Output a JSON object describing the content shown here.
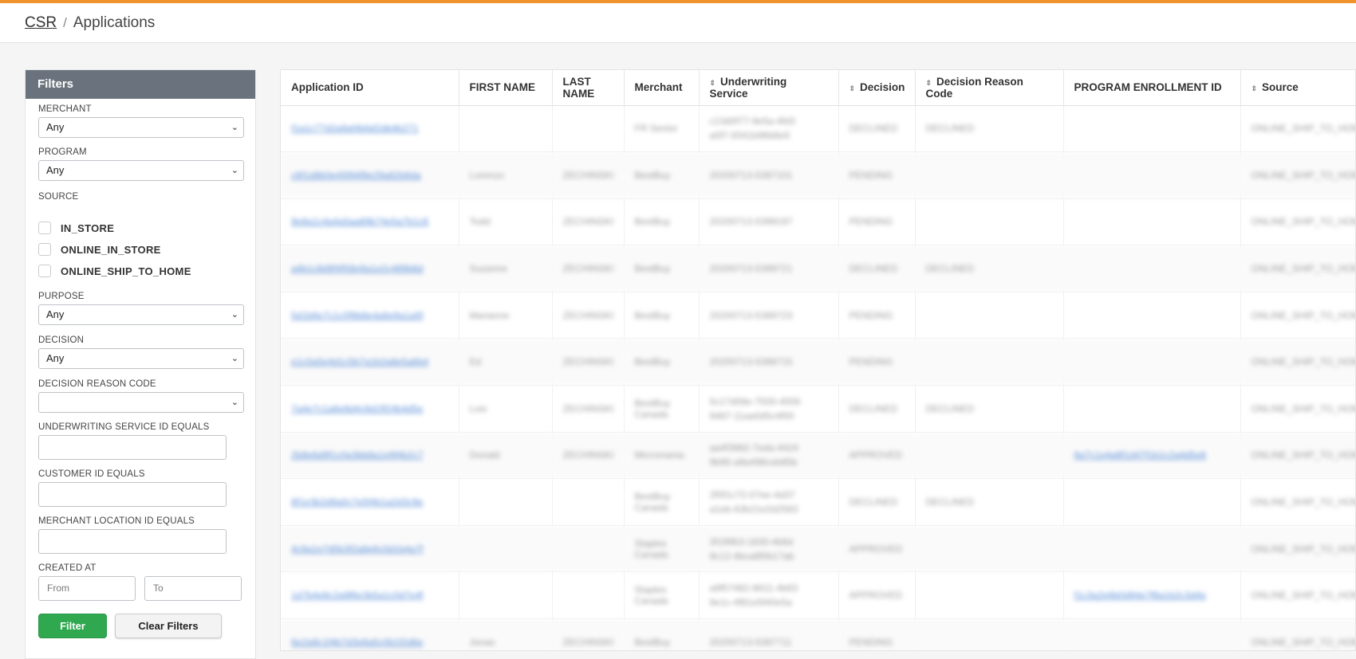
{
  "breadcrumb": {
    "root": "CSR",
    "separator": "/",
    "current": "Applications"
  },
  "filters": {
    "title": "Filters",
    "merchant": {
      "label": "MERCHANT",
      "value": "Any"
    },
    "program": {
      "label": "PROGRAM",
      "value": "Any"
    },
    "source": {
      "label": "SOURCE",
      "options": [
        "IN_STORE",
        "ONLINE_IN_STORE",
        "ONLINE_SHIP_TO_HOME"
      ]
    },
    "purpose": {
      "label": "PURPOSE",
      "value": "Any"
    },
    "decision": {
      "label": "DECISION",
      "value": "Any"
    },
    "decision_reason_code": {
      "label": "DECISION REASON CODE",
      "value": ""
    },
    "underwriting_service_id": {
      "label": "UNDERWRITING SERVICE ID EQUALS"
    },
    "customer_id": {
      "label": "CUSTOMER ID EQUALS"
    },
    "merchant_location_id": {
      "label": "MERCHANT LOCATION ID EQUALS"
    },
    "created_at": {
      "label": "CREATED AT",
      "from_placeholder": "From",
      "to_placeholder": "To"
    },
    "filter_button": "Filter",
    "clear_button": "Clear Filters"
  },
  "table": {
    "columns": [
      "Application ID",
      "FIRST NAME",
      "LAST NAME",
      "Merchant",
      "Underwriting Service",
      "Decision",
      "Decision Reason Code",
      "PROGRAM ENROLLMENT ID",
      "Source"
    ],
    "rows": [
      {
        "app": "f1a1c77d2a9af4bfaf2db4b271",
        "first": "",
        "last": "",
        "merchant": "FR Senior",
        "uw1": "c13d0f77-9e5a-4fd3",
        "uw2": "a0f7-9341b96b6e5",
        "decision": "DECLINED",
        "reason": "DECLINED",
        "enroll": "",
        "source": "ONLINE_SHIP_TO_HOME"
      },
      {
        "app": "c6f1d8b0e45f94f9e29a82b6da",
        "first": "Lorenzo",
        "last": "ZECHINSKI",
        "merchant": "BestBuy",
        "uw1": "20200713-5387101",
        "uw2": "",
        "decision": "PENDING",
        "reason": "",
        "enroll": "",
        "source": "ONLINE_SHIP_TO_HOME"
      },
      {
        "app": "9e8a1c4a4a5aa89b74e5a7b1c6",
        "first": "Todd",
        "last": "ZECHINSKI",
        "merchant": "BestBuy",
        "uw1": "20200713-5399197",
        "uw2": "",
        "decision": "PENDING",
        "reason": "",
        "enroll": "",
        "source": "ONLINE_SHIP_TO_HOME"
      },
      {
        "app": "a4b1c8d9f4f58e9a1e2c489b8d",
        "first": "Suzanne",
        "last": "ZECHINSKI",
        "merchant": "BestBuy",
        "uw1": "20200713-5399721",
        "uw2": "",
        "decision": "DECLINED",
        "reason": "DECLINED",
        "enroll": "",
        "source": "ONLINE_SHIP_TO_HOME"
      },
      {
        "app": "5d1b6e7c1c0f9b8e4a6e9a1a5f",
        "first": "Marianne",
        "last": "ZECHINSKI",
        "merchant": "BestBuy",
        "uw1": "20200713-5389723",
        "uw2": "",
        "decision": "PENDING",
        "reason": "",
        "enroll": "",
        "source": "ONLINE_SHIP_TO_HOME"
      },
      {
        "app": "e1c0a5e4d1c5b7a1b2a8e5a6b4",
        "first": "Ed",
        "last": "ZECHINSKI",
        "merchant": "BestBuy",
        "uw1": "20200713-5389715",
        "uw2": "",
        "decision": "PENDING",
        "reason": "",
        "enroll": "",
        "source": "ONLINE_SHIP_TO_HOME"
      },
      {
        "app": "7a4e7c1a6e8d4c6d1ff24b4d5e",
        "first": "Lois",
        "last": "ZECHINSKI",
        "merchant": "BestBuy Canada",
        "uw1": "5c17d58e-7500-4556",
        "uw2": "9487-11aa0d5c4f00",
        "decision": "DECLINED",
        "reason": "DECLINED",
        "enroll": "",
        "source": "ONLINE_SHIP_TO_HOME"
      },
      {
        "app": "2b8e6d9f1c0a3bb8a1e9f4b2c7",
        "first": "Donald",
        "last": "ZECHINSKI",
        "merchant": "Micromania",
        "uw1": "aa4f3982-7eda-4424",
        "uw2": "9b90-a9a498ceb85b",
        "decision": "APPROVED",
        "reason": "",
        "enroll": "6a7c1e4a8f1d47f1b1c2a4d5e8",
        "source": "ONLINE_SHIP_TO_HOME"
      },
      {
        "app": "8f1e3b2d9a0c7e5f4b1a2d3c9e",
        "first": "",
        "last": "",
        "merchant": "BestBuy Canada",
        "uw1": "2f0f1c72-07ee-4d37",
        "uw2": "a1eb-63b21e2d2583",
        "decision": "DECLINED",
        "reason": "DECLINED",
        "enroll": "",
        "source": "ONLINE_SHIP_TO_HOME"
      },
      {
        "app": "4c9a1e7d5b3f2a8e6c0d1b4a7f",
        "first": "",
        "last": "",
        "merchant": "Staples Canada",
        "uw1": "3f1f6fb3-1830-4b6d",
        "uw2": "9c12-4bca8f0b17ab",
        "decision": "APPROVED",
        "reason": "",
        "enroll": "",
        "source": "ONLINE_SHIP_TO_HOME"
      },
      {
        "app": "1d7b4e8c2a9f6e3b5a1c0d7e4f",
        "first": "",
        "last": "",
        "merchant": "Staples Canada",
        "uw1": "a9f57482-8611-4b63",
        "uw2": "9e1c-4f81e5f40e5a",
        "decision": "APPROVED",
        "reason": "",
        "enroll": "f1c3a2e6b0d94e7f8a1b2c3d4e",
        "source": "ONLINE_SHIP_TO_HOME"
      },
      {
        "app": "6e2a9c1f4b7d3e8a5c0b1f2d6e",
        "first": "Jonas",
        "last": "ZECHINSKI",
        "merchant": "BestBuy",
        "uw1": "20200713-5387711",
        "uw2": "",
        "decision": "PENDING",
        "reason": "",
        "enroll": "",
        "source": "ONLINE_SHIP_TO_HOME"
      }
    ]
  }
}
